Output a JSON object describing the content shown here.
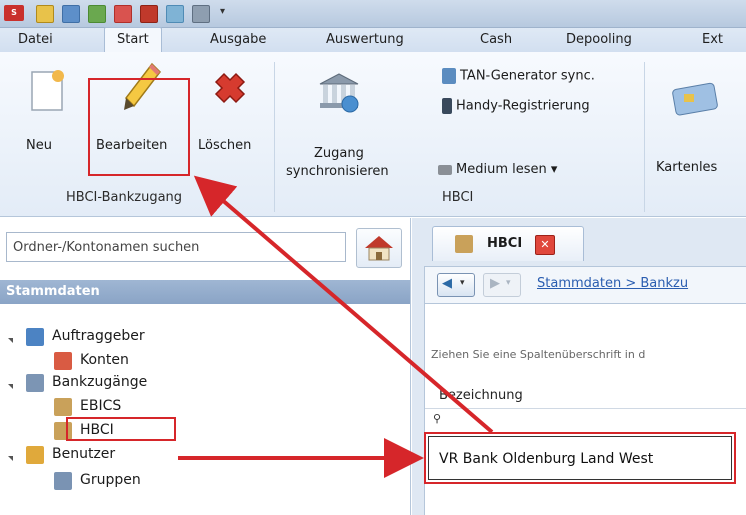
{
  "menu_tabs": [
    "Datei",
    "Start",
    "Ausgabe",
    "Auswertung",
    "Cash",
    "Depooling",
    "Ext"
  ],
  "ribbon": {
    "neu_label": "Neu",
    "bearbeiten_label": "Bearbeiten",
    "loeschen_label": "Löschen",
    "group1_label": "HBCI-Bankzugang",
    "zugang_line1": "Zugang",
    "zugang_line2": "synchronisieren",
    "tan_label": "TAN-Generator sync.",
    "handy_label": "Handy-Registrierung",
    "medium_label": "Medium lesen ▾",
    "group2_label": "HBCI",
    "kartenleser_label": "Kartenles"
  },
  "left_panel": {
    "search_placeholder": "Ordner-/Kontonamen suchen",
    "section_header": "Stammdaten",
    "tree": {
      "auftraggeber": "Auftraggeber",
      "konten": "Konten",
      "bankzugaenge": "Bankzugänge",
      "ebics": "EBICS",
      "hbci": "HBCI",
      "benutzer": "Benutzer",
      "gruppen": "Gruppen"
    }
  },
  "right_panel": {
    "doc_tab_label": "HBCI",
    "breadcrumb": "Stammdaten > Bankzu",
    "group_hint": "Ziehen Sie eine Spaltenüberschrift in d",
    "column_header": "Bezeichnung"
  },
  "callout_text": "VR Bank Oldenburg Land West",
  "colors": {
    "annotation_red": "#d6262a"
  }
}
